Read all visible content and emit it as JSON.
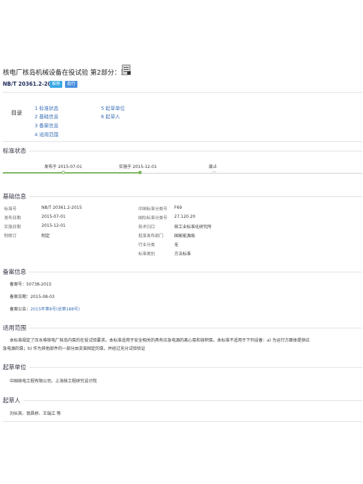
{
  "header": {
    "title": "核电厂核岛机械设备在役试验 第2部分：泵",
    "std_number": "NB/T 20361.2-2015",
    "badges": [
      "推荐",
      "现行"
    ]
  },
  "toc": {
    "label": "目录",
    "items": [
      "1 标准状态",
      "2 基础信息",
      "3 备案信息",
      "4 适用范围",
      "5 起草单位",
      "6 起草人"
    ]
  },
  "status": {
    "title": "标准状态",
    "milestones": [
      "发布于 2015-07-01",
      "实施于 2015-12-01",
      "废止"
    ]
  },
  "basic": {
    "title": "基础信息",
    "left": [
      {
        "label": "标准号",
        "value": "NB/T 20361.2-2015"
      },
      {
        "label": "发布日期",
        "value": "2015-07-01"
      },
      {
        "label": "实施日期",
        "value": "2015-12-01"
      },
      {
        "label": "制修订",
        "value": "制定"
      }
    ],
    "right": [
      {
        "label": "中国标准分类号",
        "value": "F69"
      },
      {
        "label": "国际标准分类号",
        "value": "27.120.20"
      },
      {
        "label": "技术归口",
        "value": "核工业标准化研究所"
      },
      {
        "label": "批准发布部门",
        "value": "国家能源局"
      },
      {
        "label": "行业分类",
        "value": "无"
      },
      {
        "label": "标准类别",
        "value": "方法标准"
      }
    ]
  },
  "filing": {
    "title": "备案信息",
    "number_label": "备案号：",
    "number": "50738-2015",
    "date_label": "备案日期：",
    "date": "2015-08-03",
    "notice_label": "备案公告：",
    "notice": "2015年第8号(总第188号)"
  },
  "scope": {
    "title": "适用范围",
    "text_line1": "本标准规定了压水堆核电厂核岛内泵的在役试验要求。本标准适用于安全相关的具有应急电源的离心泵和容积泵。本标准不适用于下列设备：a) 为运行方面体提供应",
    "text_line2": "急电源的泵；b) 作为其他部件的一部分由支架固定的泵，并经过充分试验验证"
  },
  "drafting_unit": {
    "title": "起草单位",
    "text": "中国核电工程有限公司、上海核工程研究设计院"
  },
  "drafters": {
    "title": "起草人",
    "text": "刘长英、翁昌桥、王端江 等"
  },
  "colors": {
    "link": "#3a6fb5",
    "badge_recommend": "#37a8e6",
    "badge_current": "#4a8fdc",
    "timeline_done": "#7ab55c"
  }
}
